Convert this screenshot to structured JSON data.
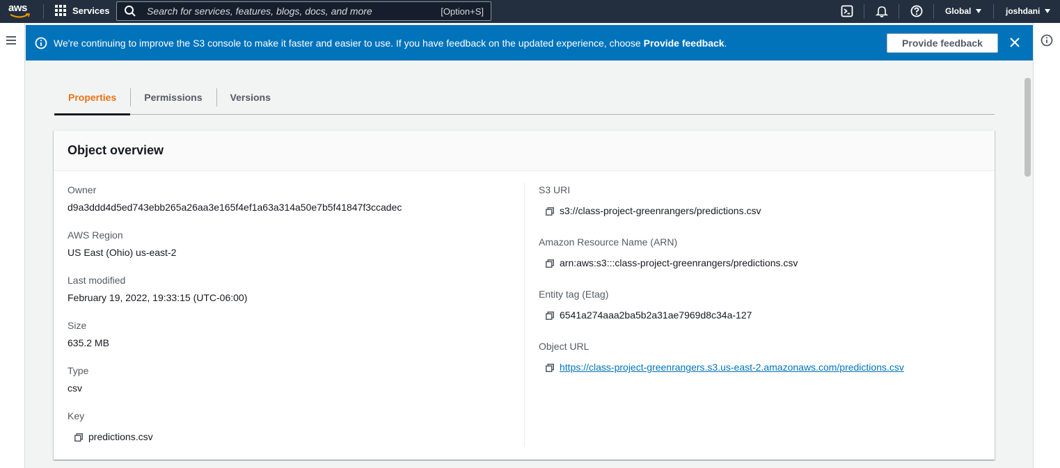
{
  "topnav": {
    "logo_text": "aws",
    "services_label": "Services",
    "search_placeholder": "Search for services, features, blogs, docs, and more",
    "search_shortcut": "[Option+S]",
    "region_label": "Global",
    "user_label": "joshdani"
  },
  "banner": {
    "message_prefix": "We're continuing to improve the S3 console to make it faster and easier to use. If you have feedback on the updated experience, choose ",
    "message_bold": "Provide feedback",
    "message_suffix": ".",
    "button_label": "Provide feedback"
  },
  "tabs": [
    {
      "label": "Properties",
      "active": true
    },
    {
      "label": "Permissions",
      "active": false
    },
    {
      "label": "Versions",
      "active": false
    }
  ],
  "overview": {
    "title": "Object overview",
    "left": [
      {
        "label": "Owner",
        "value": "d9a3ddd4d5ed743ebb265a26aa3e165f4ef1a63a314a50e7b5f41847f3ccadec"
      },
      {
        "label": "AWS Region",
        "value": "US East (Ohio) us-east-2"
      },
      {
        "label": "Last modified",
        "value": "February 19, 2022, 19:33:15 (UTC-06:00)"
      },
      {
        "label": "Size",
        "value": "635.2 MB"
      },
      {
        "label": "Type",
        "value": "csv"
      },
      {
        "label": "Key",
        "value": "predictions.csv"
      }
    ],
    "right": [
      {
        "label": "S3 URI",
        "value": "s3://class-project-greenrangers/predictions.csv"
      },
      {
        "label": "Amazon Resource Name (ARN)",
        "value": "arn:aws:s3:::class-project-greenrangers/predictions.csv"
      },
      {
        "label": "Entity tag (Etag)",
        "value": "6541a274aaa2ba5b2a31ae7969d8c34a-127"
      },
      {
        "label": "Object URL",
        "value": "https://class-project-greenrangers.s3.us-east-2.amazonaws.com/predictions.csv"
      }
    ]
  },
  "colors": {
    "topnav_bg": "#232f3e",
    "banner_bg": "#0073bb",
    "active_tab": "#ec7211",
    "link": "#0073bb"
  }
}
